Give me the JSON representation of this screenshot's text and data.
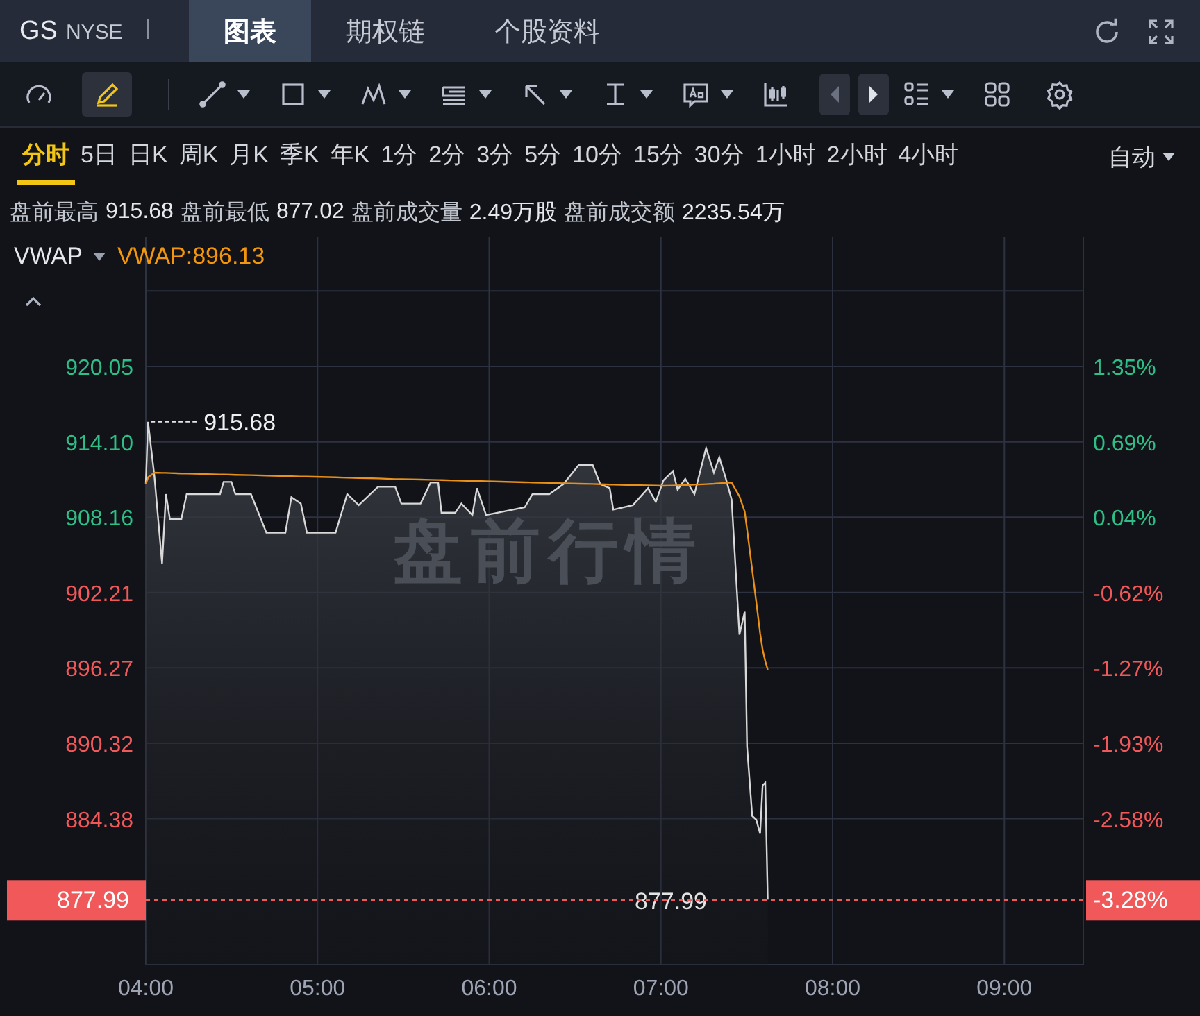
{
  "header": {
    "ticker": "GS",
    "exchange": "NYSE",
    "tabs": [
      {
        "label": "图表",
        "selected": true
      },
      {
        "label": "期权链",
        "selected": false
      },
      {
        "label": "个股资料",
        "selected": false
      }
    ]
  },
  "toolbar": {
    "tools": [
      {
        "kind": "gauge",
        "selected": false,
        "dropdown": false
      },
      {
        "kind": "pen",
        "selected": true,
        "dropdown": false
      },
      {
        "kind": "line",
        "selected": false,
        "dropdown": true
      },
      {
        "kind": "rect",
        "selected": false,
        "dropdown": true
      },
      {
        "kind": "pattern",
        "selected": false,
        "dropdown": true
      },
      {
        "kind": "fib",
        "selected": false,
        "dropdown": true
      },
      {
        "kind": "arrow",
        "selected": false,
        "dropdown": true
      },
      {
        "kind": "measure",
        "selected": false,
        "dropdown": true
      },
      {
        "kind": "text",
        "selected": false,
        "dropdown": true
      },
      {
        "kind": "candles",
        "selected": false,
        "dropdown": false
      },
      {
        "kind": "prev",
        "selected": false,
        "dropdown": false
      },
      {
        "kind": "next",
        "selected": false,
        "dropdown": false
      },
      {
        "kind": "list",
        "selected": false,
        "dropdown": true
      },
      {
        "kind": "grid",
        "selected": false,
        "dropdown": false
      },
      {
        "kind": "settings",
        "selected": false,
        "dropdown": false
      }
    ]
  },
  "periods": [
    {
      "label": "分时",
      "selected": true
    },
    {
      "label": "5日",
      "selected": false
    },
    {
      "label": "日K",
      "selected": false
    },
    {
      "label": "周K",
      "selected": false
    },
    {
      "label": "月K",
      "selected": false
    },
    {
      "label": "季K",
      "selected": false
    },
    {
      "label": "年K",
      "selected": false
    },
    {
      "label": "1分",
      "selected": false
    },
    {
      "label": "2分",
      "selected": false
    },
    {
      "label": "3分",
      "selected": false
    },
    {
      "label": "5分",
      "selected": false
    },
    {
      "label": "10分",
      "selected": false
    },
    {
      "label": "15分",
      "selected": false
    },
    {
      "label": "30分",
      "selected": false
    },
    {
      "label": "1小时",
      "selected": false
    },
    {
      "label": "2小时",
      "selected": false
    },
    {
      "label": "4小时",
      "selected": false
    }
  ],
  "scale_select": {
    "value": "自动"
  },
  "stats": [
    {
      "label": "盘前最高",
      "value": "915.68"
    },
    {
      "label": "盘前最低",
      "value": "877.02"
    },
    {
      "label": "盘前成交量",
      "value": "2.49万股"
    },
    {
      "label": "盘前成交额",
      "value": "2235.54万"
    }
  ],
  "indicator": {
    "reading": "VWAP:896.13"
  },
  "chart": {
    "watermark": "盘前行情",
    "high_marker": "915.68",
    "last_price": {
      "line_label": "877.99",
      "left_badge": "877.99",
      "right_badge": "-3.28%"
    },
    "left_axis_colors": [
      {
        "color": "#2fbf86"
      },
      {
        "color": "#2fbf86"
      },
      {
        "color": "#2fbf86"
      },
      {
        "color": "#f0585a"
      },
      {
        "color": "#f0585a"
      },
      {
        "color": "#f0585a"
      },
      {
        "color": "#f0585a"
      }
    ],
    "percent_axis": [
      {
        "label": "1.35%",
        "color": "#2fbf86"
      },
      {
        "label": "0.69%",
        "color": "#2fbf86"
      },
      {
        "label": "0.04%",
        "color": "#2fbf86"
      },
      {
        "label": "-0.62%",
        "color": "#f0585a"
      },
      {
        "label": "-1.27%",
        "color": "#f0585a"
      },
      {
        "label": "-1.93%",
        "color": "#f0585a"
      },
      {
        "label": "-2.58%",
        "color": "#f0585a"
      }
    ],
    "chart_data": {
      "type": "line",
      "grid": true,
      "xlim": [
        4,
        9.46
      ],
      "ylim": [
        872.86,
        930.23
      ],
      "xticks": [
        {
          "value": 4,
          "label": "04:00"
        },
        {
          "value": 5,
          "label": "05:00"
        },
        {
          "value": 6,
          "label": "06:00"
        },
        {
          "value": 7,
          "label": "07:00"
        },
        {
          "value": 8,
          "label": "08:00"
        },
        {
          "value": 9,
          "label": "09:00"
        }
      ],
      "yticks": [
        {
          "value": 920.05,
          "label": "920.05"
        },
        {
          "value": 914.1,
          "label": "914.10"
        },
        {
          "value": 908.16,
          "label": "908.16"
        },
        {
          "value": 902.21,
          "label": "902.21"
        },
        {
          "value": 896.27,
          "label": "896.27"
        },
        {
          "value": 890.32,
          "label": "890.32"
        },
        {
          "value": 884.38,
          "label": "884.38"
        }
      ],
      "x": [
        4,
        4.013,
        4.05,
        4.095,
        4.117,
        4.14,
        4.207,
        4.238,
        4.432,
        4.453,
        4.498,
        4.522,
        4.612,
        4.702,
        4.813,
        4.848,
        4.903,
        4.938,
        5.105,
        5.173,
        5.24,
        5.353,
        5.452,
        5.488,
        5.6,
        5.658,
        5.703,
        5.722,
        5.802,
        5.838,
        5.902,
        5.928,
        5.982,
        6.027,
        6.207,
        6.252,
        6.35,
        6.432,
        6.522,
        6.602,
        6.647,
        6.702,
        6.723,
        6.837,
        6.925,
        6.97,
        7.015,
        7.07,
        7.097,
        7.142,
        7.195,
        7.263,
        7.308,
        7.34,
        7.375,
        7.412,
        7.457,
        7.488,
        7.502,
        7.532,
        7.555,
        7.578,
        7.592,
        7.608,
        7.622
      ],
      "series": [
        {
          "color": "#d8d8d8",
          "values": [
            910.76,
            915.68,
            911.37,
            904.49,
            909.97,
            908.02,
            908.02,
            909.97,
            909.97,
            910.94,
            910.94,
            909.97,
            909.97,
            906.93,
            906.93,
            909.72,
            909.23,
            906.93,
            906.93,
            909.97,
            909.11,
            910.57,
            910.57,
            909.23,
            909.23,
            910.88,
            910.88,
            908.51,
            908.51,
            909.23,
            908.32,
            910.45,
            908.32,
            908.45,
            908.93,
            909.97,
            909.97,
            910.76,
            912.28,
            912.28,
            910.76,
            910.45,
            908.75,
            909.11,
            910.45,
            909.36,
            911.06,
            911.79,
            910.33,
            911.18,
            909.97,
            913.61,
            911.67,
            912.89,
            911.37,
            909.54,
            898.9,
            900.7,
            890.08,
            884.6,
            884.3,
            883.2,
            887.0,
            887.2,
            877.99
          ]
        },
        {
          "name": "VWAP",
          "color": "#e8901a",
          "values": [
            910.76,
            911.3,
            911.67,
            911.65,
            911.65,
            911.64,
            911.61,
            911.6,
            911.53,
            911.53,
            911.51,
            911.5,
            911.47,
            911.44,
            911.4,
            911.39,
            911.37,
            911.36,
            911.3,
            911.27,
            911.25,
            911.21,
            911.16,
            911.16,
            911.12,
            911.1,
            911.09,
            911.08,
            911.05,
            911.04,
            911.02,
            911.01,
            910.99,
            910.97,
            910.91,
            910.89,
            910.86,
            910.83,
            910.8,
            910.77,
            910.75,
            910.73,
            910.73,
            910.69,
            910.66,
            910.64,
            910.63,
            910.65,
            910.66,
            910.69,
            910.72,
            910.76,
            910.8,
            910.83,
            910.86,
            910.88,
            909.8,
            908.6,
            907.2,
            904.0,
            901.5,
            899.0,
            897.7,
            896.8,
            896.13
          ]
        }
      ]
    }
  }
}
